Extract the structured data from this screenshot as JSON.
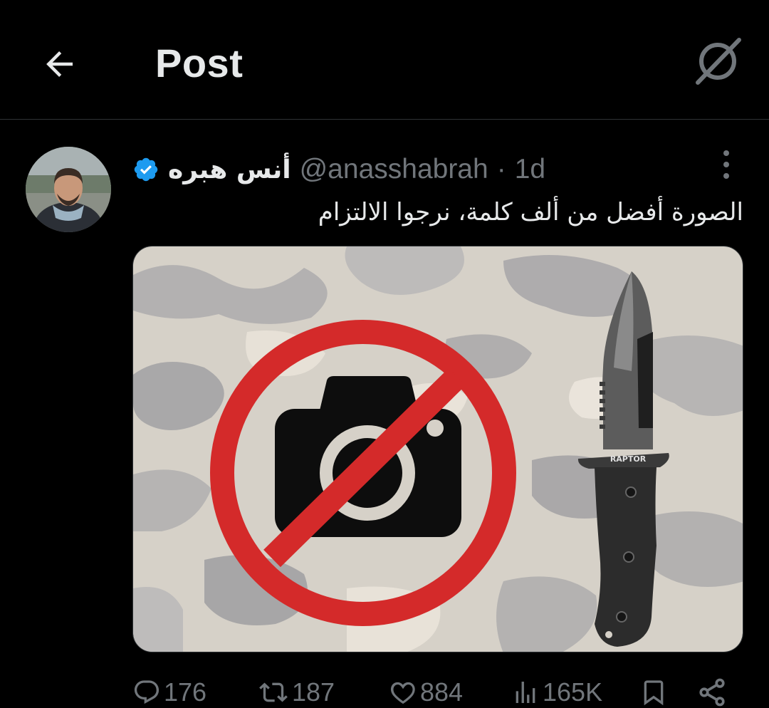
{
  "header": {
    "title": "Post",
    "back_icon": "arrow-left-icon",
    "grok_icon": "grok-icon"
  },
  "post": {
    "display_name": "أنس هبره",
    "verified": true,
    "handle": "@anasshabrah",
    "separator": "·",
    "time": "1d",
    "text": "الصورة أفضل من ألف كلمة، نرجوا الالتزام",
    "media": {
      "knife_brand": "RAPTOR",
      "prohibition_color": "#d42a2a",
      "camera_color": "#0d0d0d"
    }
  },
  "actions": {
    "replies": "176",
    "reposts": "187",
    "likes": "884",
    "views": "165K"
  },
  "colors": {
    "background": "#000000",
    "text_primary": "#e7e9ea",
    "text_secondary": "#71767b",
    "verified_blue": "#1d9bf0",
    "divider": "#2f3336"
  }
}
